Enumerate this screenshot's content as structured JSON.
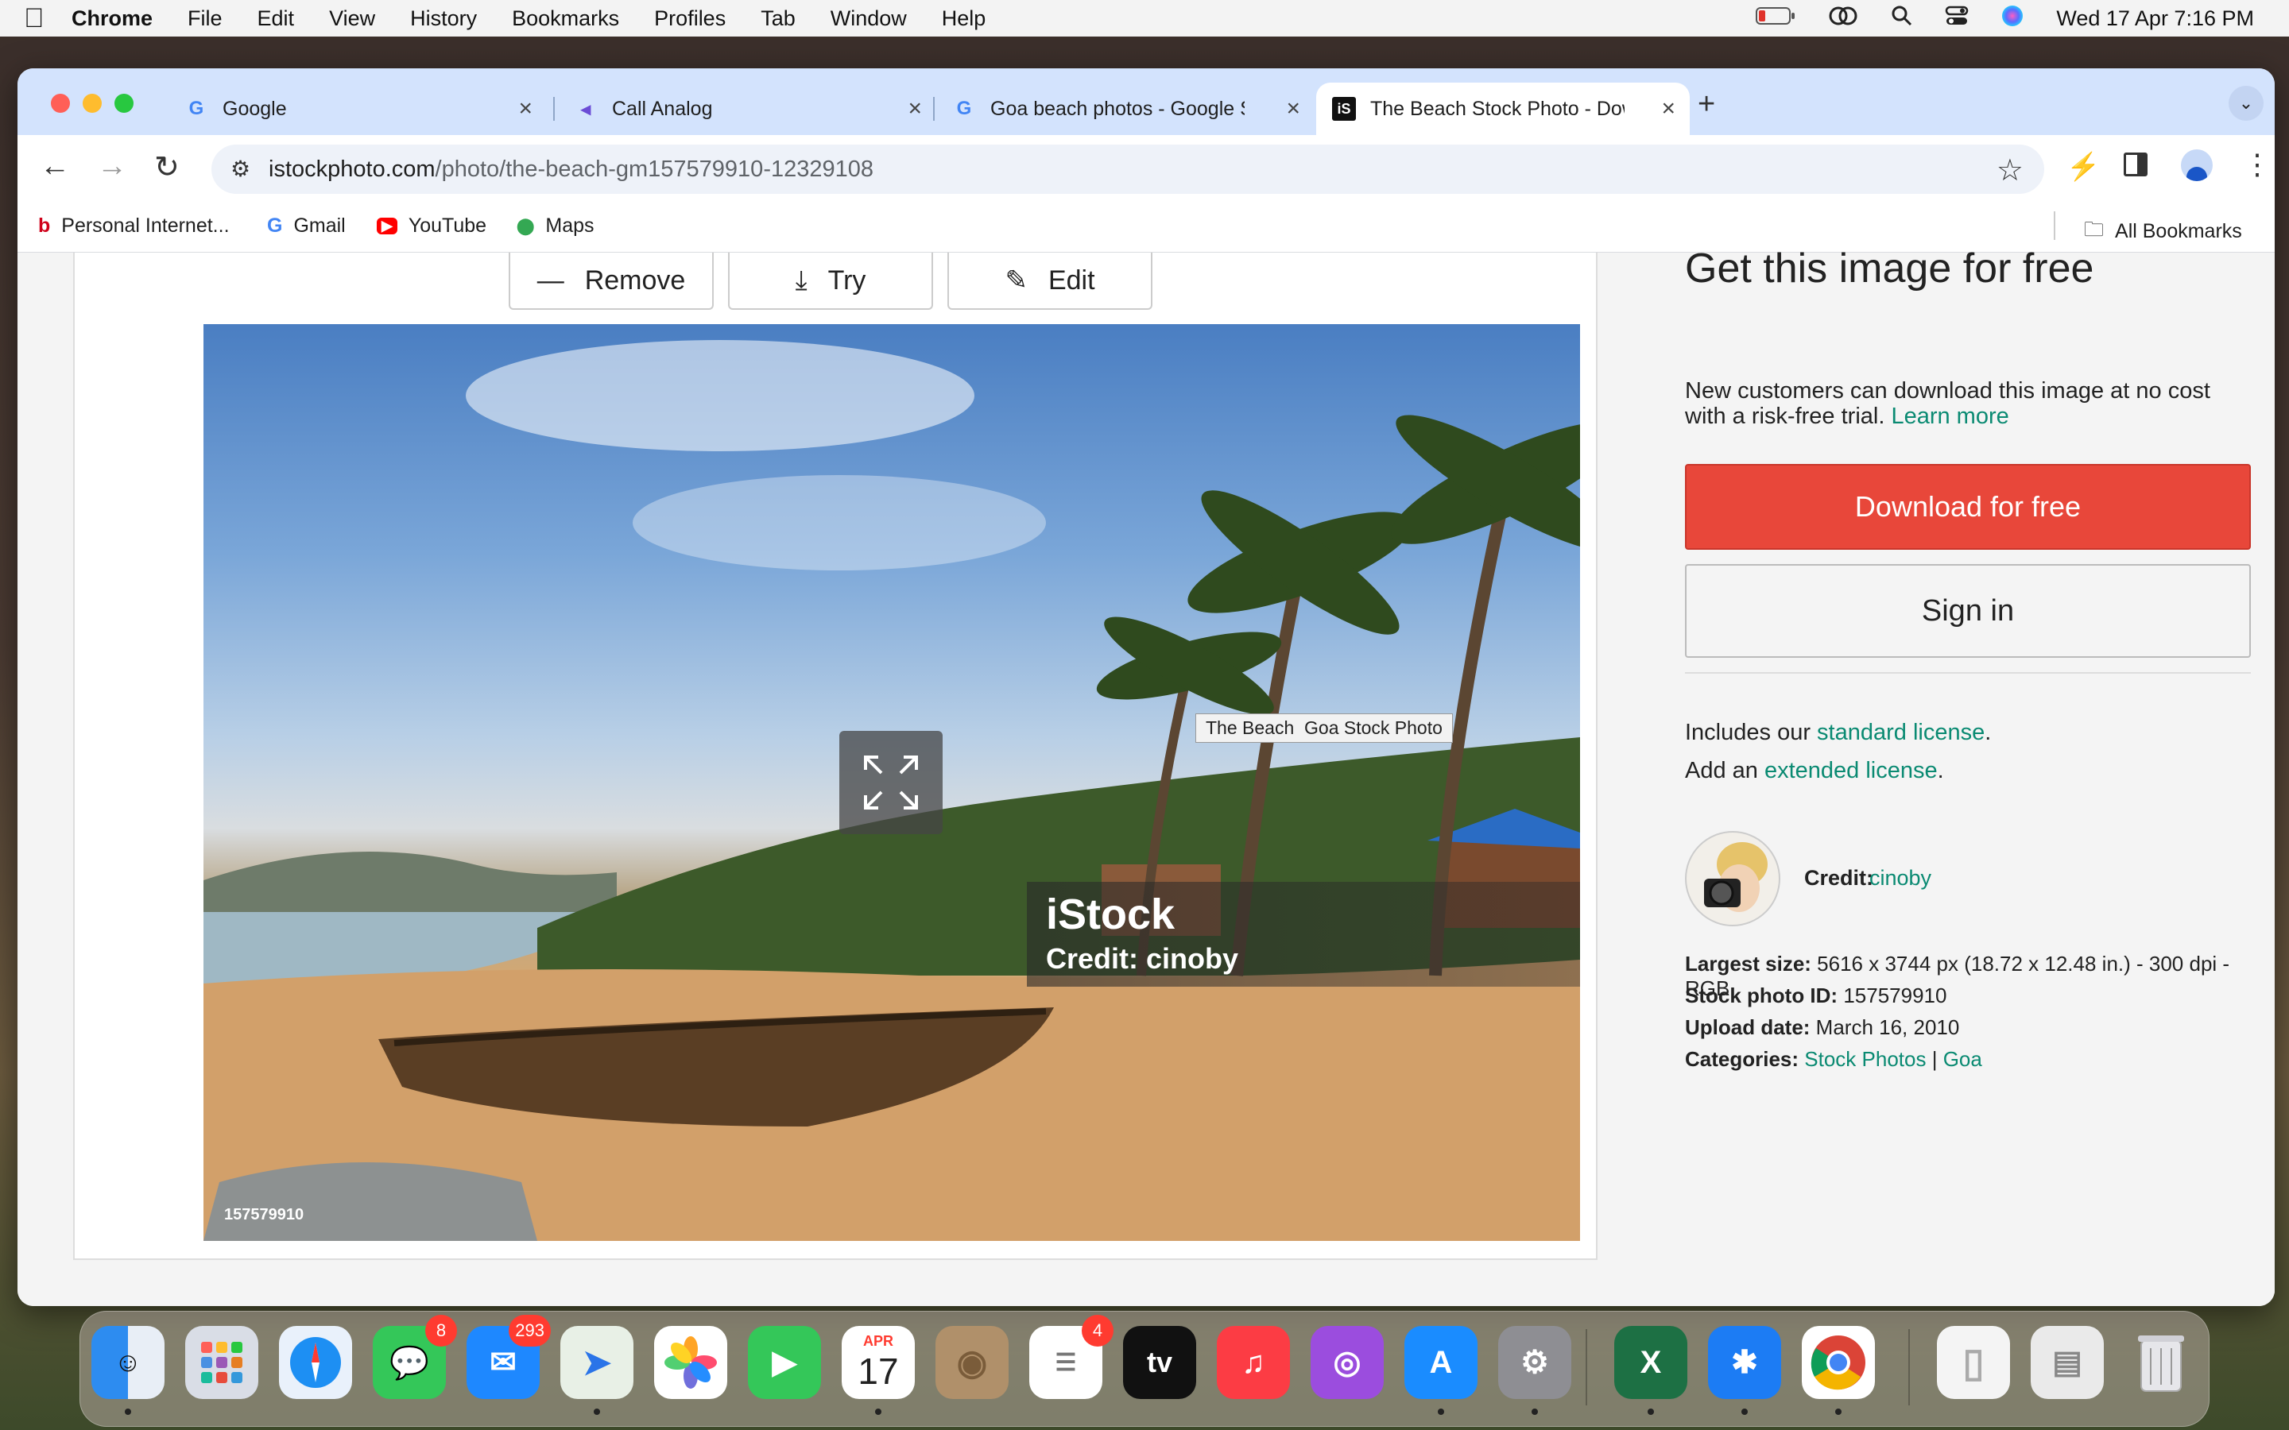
{
  "menubar": {
    "apple": "",
    "items": [
      "Chrome",
      "File",
      "Edit",
      "View",
      "History",
      "Bookmarks",
      "Profiles",
      "Tab",
      "Window",
      "Help"
    ],
    "clock": "Wed 17 Apr  7:16 PM"
  },
  "tabs": [
    {
      "title": "Google",
      "favicon": "G",
      "favicon_color": "#4285f4"
    },
    {
      "title": "Call Analog",
      "favicon": "◂",
      "favicon_color": "#6b4cd6"
    },
    {
      "title": "Goa beach photos - Google S",
      "favicon": "G",
      "favicon_color": "#4285f4"
    },
    {
      "title": "The Beach Stock Photo - Dow",
      "favicon": "iS",
      "favicon_color": "#111111"
    }
  ],
  "address": {
    "host": "istockphoto.com",
    "path": "/photo/the-beach-gm157579910-12329108"
  },
  "bookmarks": [
    {
      "label": "Personal Internet...",
      "icon": "b"
    },
    {
      "label": "Gmail",
      "icon": "G"
    },
    {
      "label": "YouTube",
      "icon": "▶"
    },
    {
      "label": "Maps",
      "icon": "⬤"
    }
  ],
  "all_bookmarks": "All Bookmarks",
  "actions": {
    "remove": "Remove",
    "try": "Try",
    "edit": "Edit"
  },
  "photo": {
    "tooltip": "The Beach  Goa Stock Photo",
    "watermark_brand": "iStock",
    "watermark_credit": "Credit: cinoby",
    "id_label": "157579910"
  },
  "offer": {
    "heading": "Get this image for free",
    "desc_line1": "New customers can download this image at no cost",
    "desc_line2": "with a risk-free trial.",
    "learn_more": "Learn more",
    "download": "Download for free",
    "sign_in": "Sign in"
  },
  "license": {
    "includes_prefix": "Includes our ",
    "standard": "standard license",
    "add_prefix": "Add an ",
    "extended": "extended license",
    "period": "."
  },
  "credit": {
    "label": "Credit:",
    "name": "cinoby"
  },
  "details": {
    "size_label": "Largest size:",
    "size_value": " 5616 x 3744 px (18.72 x 12.48 in.) - 300 dpi - RGB",
    "id_label": "Stock photo ID:",
    "id_value": " 157579910",
    "date_label": "Upload date:",
    "date_value": " March 16, 2010",
    "cat_label": "Categories:",
    "cat1": "Stock Photos",
    "sep": " | ",
    "cat2": "Goa"
  },
  "dock": {
    "badges": {
      "messages": "8",
      "mail": "293",
      "reminders": "4"
    },
    "calendar_month": "APR",
    "calendar_day": "17",
    "tv_label": "tv"
  }
}
